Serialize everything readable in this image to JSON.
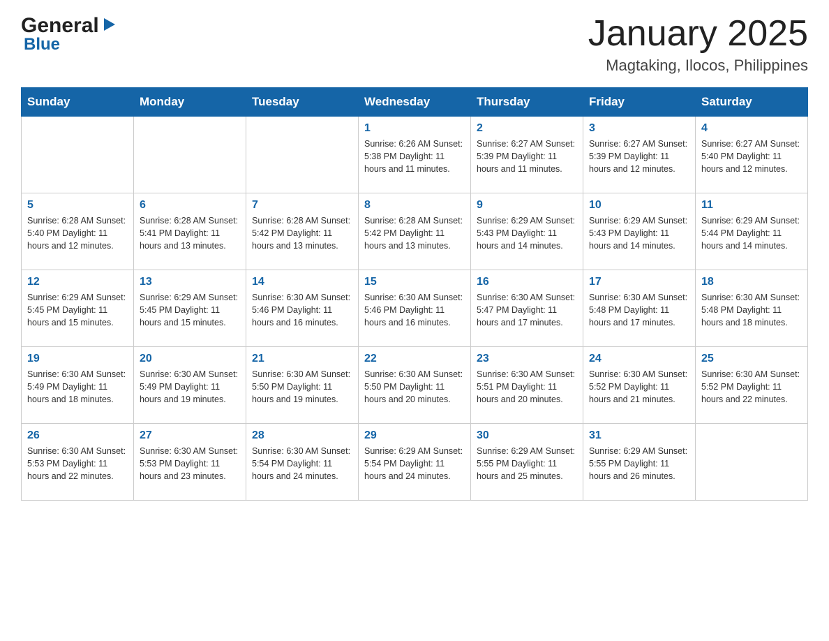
{
  "logo": {
    "general": "General",
    "blue": "Blue"
  },
  "header": {
    "month": "January 2025",
    "location": "Magtaking, Ilocos, Philippines"
  },
  "weekdays": [
    "Sunday",
    "Monday",
    "Tuesday",
    "Wednesday",
    "Thursday",
    "Friday",
    "Saturday"
  ],
  "weeks": [
    [
      {
        "day": "",
        "info": ""
      },
      {
        "day": "",
        "info": ""
      },
      {
        "day": "",
        "info": ""
      },
      {
        "day": "1",
        "info": "Sunrise: 6:26 AM\nSunset: 5:38 PM\nDaylight: 11 hours\nand 11 minutes."
      },
      {
        "day": "2",
        "info": "Sunrise: 6:27 AM\nSunset: 5:39 PM\nDaylight: 11 hours\nand 11 minutes."
      },
      {
        "day": "3",
        "info": "Sunrise: 6:27 AM\nSunset: 5:39 PM\nDaylight: 11 hours\nand 12 minutes."
      },
      {
        "day": "4",
        "info": "Sunrise: 6:27 AM\nSunset: 5:40 PM\nDaylight: 11 hours\nand 12 minutes."
      }
    ],
    [
      {
        "day": "5",
        "info": "Sunrise: 6:28 AM\nSunset: 5:40 PM\nDaylight: 11 hours\nand 12 minutes."
      },
      {
        "day": "6",
        "info": "Sunrise: 6:28 AM\nSunset: 5:41 PM\nDaylight: 11 hours\nand 13 minutes."
      },
      {
        "day": "7",
        "info": "Sunrise: 6:28 AM\nSunset: 5:42 PM\nDaylight: 11 hours\nand 13 minutes."
      },
      {
        "day": "8",
        "info": "Sunrise: 6:28 AM\nSunset: 5:42 PM\nDaylight: 11 hours\nand 13 minutes."
      },
      {
        "day": "9",
        "info": "Sunrise: 6:29 AM\nSunset: 5:43 PM\nDaylight: 11 hours\nand 14 minutes."
      },
      {
        "day": "10",
        "info": "Sunrise: 6:29 AM\nSunset: 5:43 PM\nDaylight: 11 hours\nand 14 minutes."
      },
      {
        "day": "11",
        "info": "Sunrise: 6:29 AM\nSunset: 5:44 PM\nDaylight: 11 hours\nand 14 minutes."
      }
    ],
    [
      {
        "day": "12",
        "info": "Sunrise: 6:29 AM\nSunset: 5:45 PM\nDaylight: 11 hours\nand 15 minutes."
      },
      {
        "day": "13",
        "info": "Sunrise: 6:29 AM\nSunset: 5:45 PM\nDaylight: 11 hours\nand 15 minutes."
      },
      {
        "day": "14",
        "info": "Sunrise: 6:30 AM\nSunset: 5:46 PM\nDaylight: 11 hours\nand 16 minutes."
      },
      {
        "day": "15",
        "info": "Sunrise: 6:30 AM\nSunset: 5:46 PM\nDaylight: 11 hours\nand 16 minutes."
      },
      {
        "day": "16",
        "info": "Sunrise: 6:30 AM\nSunset: 5:47 PM\nDaylight: 11 hours\nand 17 minutes."
      },
      {
        "day": "17",
        "info": "Sunrise: 6:30 AM\nSunset: 5:48 PM\nDaylight: 11 hours\nand 17 minutes."
      },
      {
        "day": "18",
        "info": "Sunrise: 6:30 AM\nSunset: 5:48 PM\nDaylight: 11 hours\nand 18 minutes."
      }
    ],
    [
      {
        "day": "19",
        "info": "Sunrise: 6:30 AM\nSunset: 5:49 PM\nDaylight: 11 hours\nand 18 minutes."
      },
      {
        "day": "20",
        "info": "Sunrise: 6:30 AM\nSunset: 5:49 PM\nDaylight: 11 hours\nand 19 minutes."
      },
      {
        "day": "21",
        "info": "Sunrise: 6:30 AM\nSunset: 5:50 PM\nDaylight: 11 hours\nand 19 minutes."
      },
      {
        "day": "22",
        "info": "Sunrise: 6:30 AM\nSunset: 5:50 PM\nDaylight: 11 hours\nand 20 minutes."
      },
      {
        "day": "23",
        "info": "Sunrise: 6:30 AM\nSunset: 5:51 PM\nDaylight: 11 hours\nand 20 minutes."
      },
      {
        "day": "24",
        "info": "Sunrise: 6:30 AM\nSunset: 5:52 PM\nDaylight: 11 hours\nand 21 minutes."
      },
      {
        "day": "25",
        "info": "Sunrise: 6:30 AM\nSunset: 5:52 PM\nDaylight: 11 hours\nand 22 minutes."
      }
    ],
    [
      {
        "day": "26",
        "info": "Sunrise: 6:30 AM\nSunset: 5:53 PM\nDaylight: 11 hours\nand 22 minutes."
      },
      {
        "day": "27",
        "info": "Sunrise: 6:30 AM\nSunset: 5:53 PM\nDaylight: 11 hours\nand 23 minutes."
      },
      {
        "day": "28",
        "info": "Sunrise: 6:30 AM\nSunset: 5:54 PM\nDaylight: 11 hours\nand 24 minutes."
      },
      {
        "day": "29",
        "info": "Sunrise: 6:29 AM\nSunset: 5:54 PM\nDaylight: 11 hours\nand 24 minutes."
      },
      {
        "day": "30",
        "info": "Sunrise: 6:29 AM\nSunset: 5:55 PM\nDaylight: 11 hours\nand 25 minutes."
      },
      {
        "day": "31",
        "info": "Sunrise: 6:29 AM\nSunset: 5:55 PM\nDaylight: 11 hours\nand 26 minutes."
      },
      {
        "day": "",
        "info": ""
      }
    ]
  ]
}
